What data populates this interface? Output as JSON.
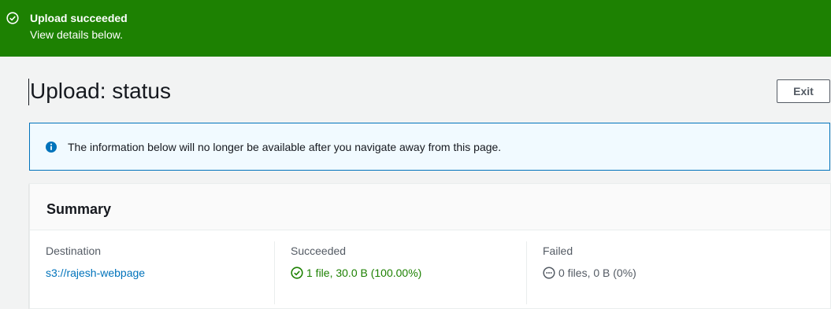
{
  "banner": {
    "title": "Upload succeeded",
    "subtitle": "View details below.",
    "color": "#1d8102",
    "icon": "check-circle-icon"
  },
  "page": {
    "title": "Upload: status",
    "exit_label": "Exit"
  },
  "alert": {
    "icon": "info-circle-icon",
    "text": "The information below will no longer be available after you navigate away from this page."
  },
  "summary": {
    "title": "Summary",
    "destination": {
      "label": "Destination",
      "value": "s3://rajesh-webpage"
    },
    "succeeded": {
      "label": "Succeeded",
      "value": "1 file, 30.0 B (100.00%)",
      "icon": "check-circle-icon"
    },
    "failed": {
      "label": "Failed",
      "value": "0 files, 0 B (0%)",
      "icon": "pending-circle-icon"
    }
  }
}
